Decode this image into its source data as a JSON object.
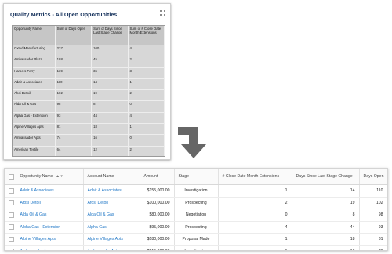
{
  "report": {
    "title": "Quality Metrics - All Open Opportunities",
    "menu_icon": "grid-icon",
    "headers": [
      "Opportunity Name",
      "Sum of Days Open",
      "Sum of Days Since Last Stage Change",
      "Sum of # Close Date Month Extensions"
    ],
    "rows": [
      [
        "Oxted Manufacturing",
        "237",
        "100",
        "4"
      ],
      [
        "Ambassador Plaza",
        "188",
        "45",
        "2"
      ],
      [
        "Harpers Ferry",
        "139",
        "36",
        "3"
      ],
      [
        "Adair & Associates",
        "110",
        "14",
        "1"
      ],
      [
        "Ahoi Detoil",
        "102",
        "19",
        "2"
      ],
      [
        "Alda Oil & Gas",
        "98",
        "8",
        "0"
      ],
      [
        "Alpha Gas - Extension",
        "93",
        "44",
        "4"
      ],
      [
        "Alpine Villages Apts",
        "81",
        "18",
        "1"
      ],
      [
        "Ambassador Apts",
        "74",
        "16",
        "0"
      ],
      [
        "American Textile",
        "64",
        "12",
        "2"
      ]
    ]
  },
  "arrow_icon": "arrow-down-right-icon",
  "grid": {
    "headers": {
      "opportunity": "Opportunity Name",
      "account": "Account Name",
      "amount": "Amount",
      "stage": "Stage",
      "extensions": "# Close Date Month Extensions",
      "days_since": "Days Since Last Stage Change",
      "days_open": "Days Open"
    },
    "sort_indicator": "▲ ▾",
    "rows": [
      {
        "opportunity": "Adair & Associates",
        "account": "Adair & Associates",
        "amount": "$155,000.00",
        "stage": "Investigation",
        "extensions": "1",
        "days_since": "14",
        "days_open": "110"
      },
      {
        "opportunity": "Afosi Detoil",
        "account": "Afosi Detoil",
        "amount": "$100,000.00",
        "stage": "Prospecting",
        "extensions": "2",
        "days_since": "19",
        "days_open": "102"
      },
      {
        "opportunity": "Alda Oil & Gas",
        "account": "Alda Oil & Gas",
        "amount": "$80,000.00",
        "stage": "Negotiation",
        "extensions": "0",
        "days_since": "8",
        "days_open": "98"
      },
      {
        "opportunity": "Alpha Gas - Extension",
        "account": "Alpha Gas",
        "amount": "$95,000.00",
        "stage": "Prospecting",
        "extensions": "4",
        "days_since": "44",
        "days_open": "93"
      },
      {
        "opportunity": "Alpine Villages Apts",
        "account": "Alpine Villages Apts",
        "amount": "$180,000.00",
        "stage": "Proposal Made",
        "extensions": "1",
        "days_since": "18",
        "days_open": "81"
      },
      {
        "opportunity": "Ambassador Apt",
        "account": "Ambassador Apt",
        "amount": "$215,000.00",
        "stage": "Investigation",
        "extensions": "1",
        "days_since": "16",
        "days_open": "76"
      }
    ]
  }
}
